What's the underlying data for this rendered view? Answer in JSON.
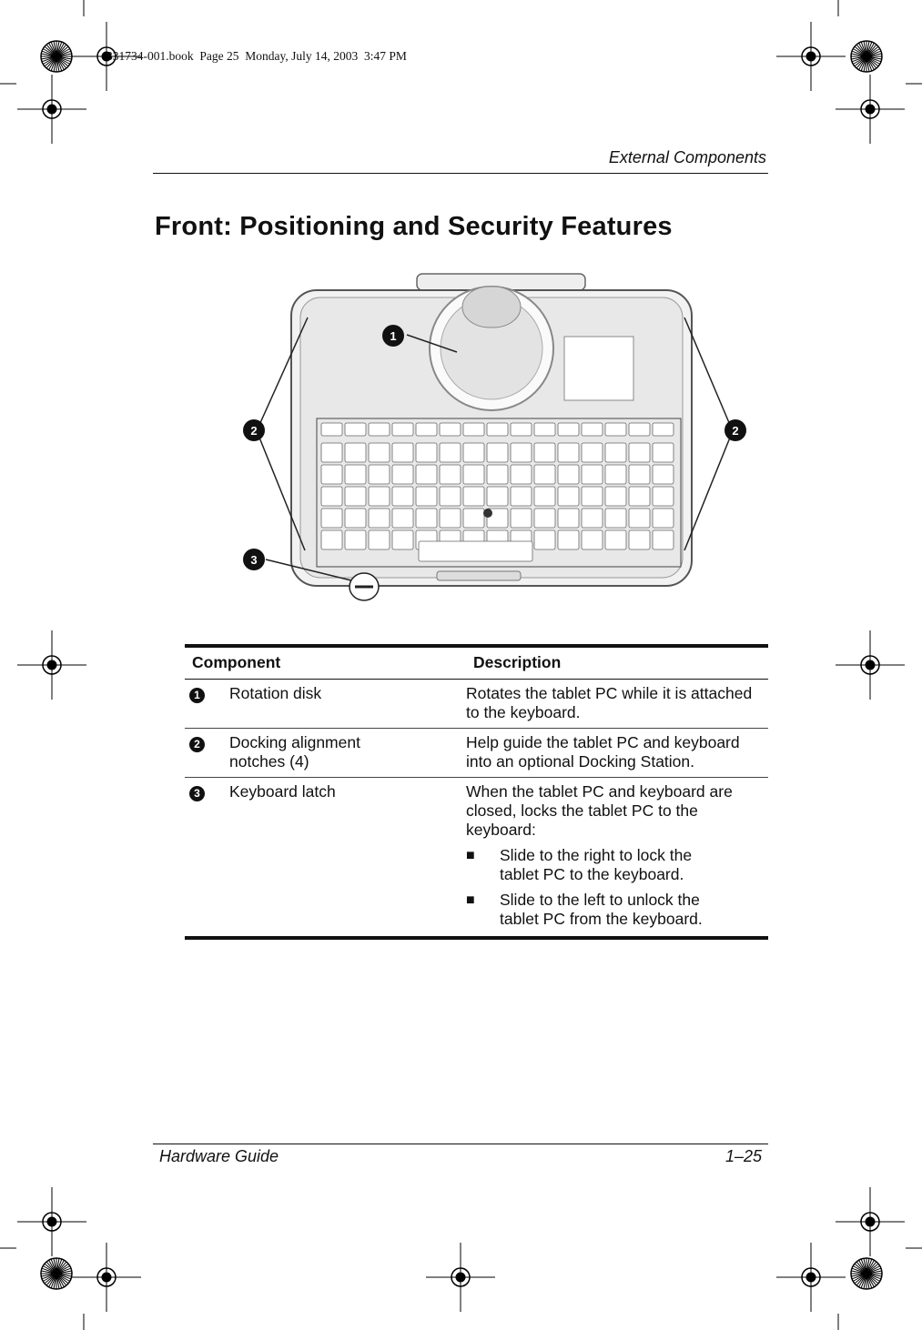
{
  "slug": "331734-001.book  Page 25  Monday, July 14, 2003  3:47 PM",
  "header": {
    "running_title": "External Components"
  },
  "page_title": "Front: Positioning and Security Features",
  "figure": {
    "callouts": [
      "1",
      "2",
      "2",
      "3"
    ]
  },
  "table": {
    "headers": [
      "Component",
      "Description"
    ],
    "rows": [
      {
        "num": "1",
        "component": "Rotation disk",
        "description": "Rotates the tablet PC while it is attached to the keyboard."
      },
      {
        "num": "2",
        "component": "Docking alignment notches (4)",
        "description": "Help guide the tablet PC and keyboard into an optional Docking Station."
      },
      {
        "num": "3",
        "component": "Keyboard latch",
        "description": "When the tablet PC and keyboard are closed, locks the tablet PC to the keyboard:",
        "bullets": [
          "Slide to the right to lock the tablet PC to the keyboard.",
          "Slide to the left to unlock the tablet PC from the keyboard."
        ]
      }
    ]
  },
  "footer": {
    "left": "Hardware Guide",
    "right": "1–25"
  },
  "bullet_glyph": "■"
}
